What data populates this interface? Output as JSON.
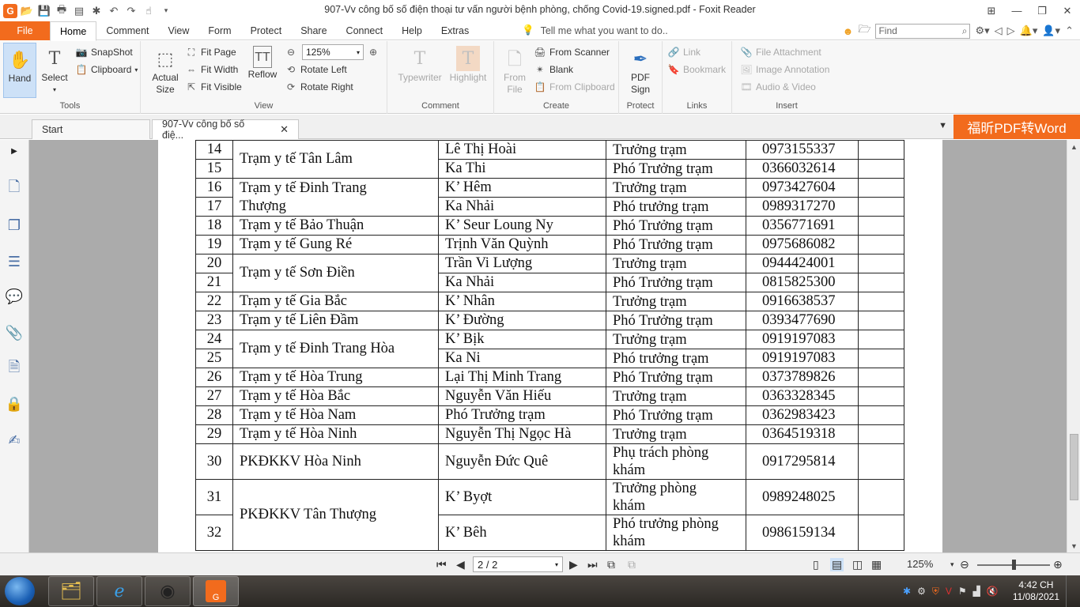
{
  "window": {
    "title": "907-Vv công bố số điện thoại tư vấn người bệnh phòng, chống Covid-19.signed.pdf - Foxit Reader"
  },
  "menu": {
    "file": "File",
    "tabs": [
      "Home",
      "Comment",
      "View",
      "Form",
      "Protect",
      "Share",
      "Connect",
      "Help",
      "Extras"
    ],
    "tell_me": "Tell me what you want to do..",
    "find_placeholder": "Find"
  },
  "ribbon": {
    "tools": {
      "label": "Tools",
      "hand": "Hand",
      "select": "Select",
      "snapshot": "SnapShot",
      "clipboard": "Clipboard"
    },
    "view": {
      "label": "View",
      "actual_size_1": "Actual",
      "actual_size_2": "Size",
      "fit_page": "Fit Page",
      "fit_width": "Fit Width",
      "fit_visible": "Fit Visible",
      "reflow": "Reflow",
      "zoom": "125%",
      "rotate_left": "Rotate Left",
      "rotate_right": "Rotate Right"
    },
    "comment": {
      "label": "Comment",
      "typewriter": "Typewriter",
      "highlight": "Highlight"
    },
    "create": {
      "label": "Create",
      "from_file_1": "From",
      "from_file_2": "File",
      "from_scanner": "From Scanner",
      "blank": "Blank",
      "from_clipboard": "From Clipboard"
    },
    "protect": {
      "label": "Protect",
      "pdf_sign_1": "PDF",
      "pdf_sign_2": "Sign"
    },
    "links": {
      "label": "Links",
      "link": "Link",
      "bookmark": "Bookmark"
    },
    "insert": {
      "label": "Insert",
      "file_attachment": "File Attachment",
      "image_annotation": "Image Annotation",
      "audio_video": "Audio & Video"
    }
  },
  "tabs": {
    "start": "Start",
    "doc": "907-Vv công bố số điệ...",
    "promo": "福昕PDF转Word"
  },
  "table": {
    "rows": [
      {
        "n": "14",
        "name": "Lê Thị Hoài",
        "role": "Trưởng trạm",
        "phone": "0973155337"
      },
      {
        "n": "15",
        "name": "Ka Thi",
        "role": "Phó Trưởng trạm",
        "phone": "0366032614"
      },
      {
        "n": "16",
        "name": "K’ Hêm",
        "role": "Trưởng trạm",
        "phone": "0973427604"
      },
      {
        "n": "17",
        "name": "Ka Nhải",
        "role": "Phó trưởng trạm",
        "phone": "0989317270"
      },
      {
        "n": "18",
        "name": "K’ Seur Loung Ny",
        "role": "Phó Trưởng trạm",
        "phone": "0356771691"
      },
      {
        "n": "19",
        "name": "Trịnh Văn Quỳnh",
        "role": "Phó Trưởng trạm",
        "phone": "0975686082"
      },
      {
        "n": "20",
        "name": "Trần Vi Lượng",
        "role": "Trưởng trạm",
        "phone": "0944424001"
      },
      {
        "n": "21",
        "name": "Ka Nhải",
        "role": "Phó Trưởng trạm",
        "phone": "0815825300"
      },
      {
        "n": "22",
        "name": "K’ Nhân",
        "role": "Trưởng trạm",
        "phone": "0916638537"
      },
      {
        "n": "23",
        "name": "K’ Đường",
        "role": "Phó Trưởng trạm",
        "phone": "0393477690"
      },
      {
        "n": "24",
        "name": "K’ Bịk",
        "role": "Trưởng trạm",
        "phone": "0919197083"
      },
      {
        "n": "25",
        "name": "Ka Ni",
        "role": "Phó trưởng trạm",
        "phone": "0919197083"
      },
      {
        "n": "26",
        "name": "Lại Thị Minh Trang",
        "role": "Phó Trưởng trạm",
        "phone": "0373789826"
      },
      {
        "n": "27",
        "name": "Nguyễn Văn Hiếu",
        "role": "Trưởng trạm",
        "phone": "0363328345"
      },
      {
        "n": "28",
        "name": "Phó Trưởng trạm",
        "role": "Phó Trưởng trạm",
        "phone": "0362983423"
      },
      {
        "n": "29",
        "name": "Nguyễn Thị Ngọc Hà",
        "role": "Trưởng trạm",
        "phone": "0364519318"
      },
      {
        "n": "30",
        "name": "Nguyễn Đức Quê",
        "role_1": "Phụ trách phòng",
        "role_2": "khám",
        "phone": "0917295814"
      },
      {
        "n": "31",
        "name": "K’ Byợt",
        "role_1": "Trưởng phòng",
        "role_2": "khám",
        "phone": "0989248025"
      },
      {
        "n": "32",
        "name": "K’ Bêh",
        "role_1": "Phó trưởng phòng",
        "role_2": "khám",
        "phone": "0986159134"
      }
    ],
    "units": {
      "tan_lam": "Trạm y tế Tân Lâm",
      "dinh_trang_thuong_1": "Trạm y tế Đinh Trang",
      "dinh_trang_thuong_2": "Thượng",
      "bao_thuan": "Trạm y tế Bảo Thuận",
      "gung_re": "Trạm y tế Gung Ré",
      "son_dien": "Trạm y tế Sơn Điền",
      "gia_bac": "Trạm y tế Gia Bắc",
      "lien_dam": "Trạm y tế Liên Đầm",
      "dinh_trang_hoa": "Trạm y tế Đinh Trang Hòa",
      "hoa_trung": "Trạm y tế Hòa Trung",
      "hoa_bac": "Trạm y tế Hòa Bắc",
      "hoa_nam": "Trạm y tế Hòa Nam",
      "hoa_ninh": "Trạm y tế Hòa Ninh",
      "pk_hoa_ninh": "PKĐKKV Hòa Ninh",
      "pk_tan_thuong": "PKĐKKV Tân Thượng"
    }
  },
  "status": {
    "page": "2 / 2",
    "zoom": "125%"
  },
  "taskbar": {
    "time": "4:42 CH",
    "date": "11/08/2021"
  },
  "colors": {
    "accent": "#f26b1d",
    "ribbon_bg": "#f7f7f7",
    "doc_bg": "#ababab"
  }
}
